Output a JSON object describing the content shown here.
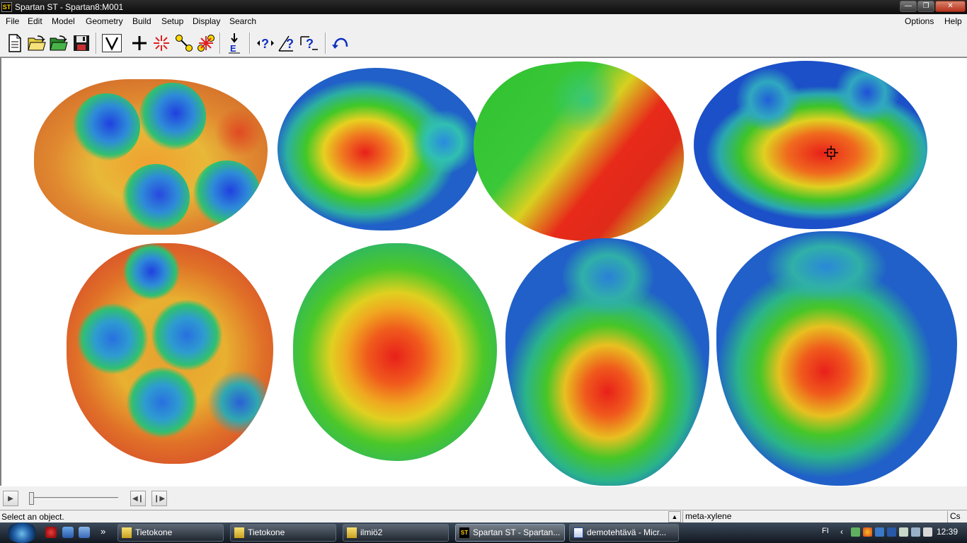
{
  "window": {
    "title": "Spartan ST - Spartan8:M001",
    "app_icon": "ST"
  },
  "menu": {
    "file": "File",
    "edit": "Edit",
    "model": "Model",
    "geometry": "Geometry",
    "build": "Build",
    "setup": "Setup",
    "display": "Display",
    "search": "Search",
    "options": "Options",
    "help": "Help"
  },
  "toolbar_icons": [
    "new-file-icon",
    "open-folder-icon",
    "open-recent-icon",
    "save-icon",
    "view-icon",
    "add-fragment-icon",
    "delete-icon",
    "make-bond-icon",
    "break-bond-icon",
    "minimize-energy-icon",
    "measure-distance-icon",
    "measure-angle-icon",
    "measure-dihedral-icon",
    "undo-icon"
  ],
  "colors": {
    "esp_red": "#e8201a",
    "esp_yellow": "#f0d21e",
    "esp_green": "#2ec62a",
    "esp_blue": "#1848d0",
    "titlebar": "#111111",
    "chrome": "#f0f0f0",
    "taskbar": "#1f2a38"
  },
  "status": {
    "message": "Select an object.",
    "molecule_name": "meta-xylene",
    "symmetry": "Cs"
  },
  "taskbar": {
    "items": [
      {
        "label": "Tietokone"
      },
      {
        "label": "Tietokone"
      },
      {
        "label": "ilmiö2"
      },
      {
        "label": "Spartan ST - Spartan..."
      },
      {
        "label": "demotehtävä - Micr..."
      }
    ],
    "language": "FI",
    "clock": "12:39"
  }
}
